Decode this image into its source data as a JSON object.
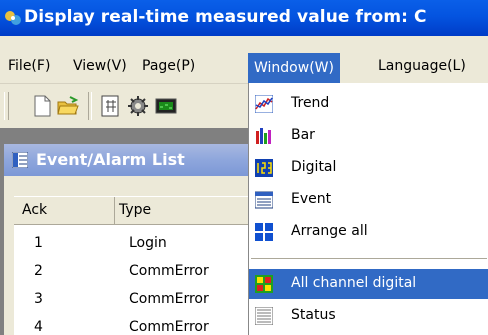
{
  "window": {
    "title": "Display real-time measured value from: C"
  },
  "menubar": {
    "items": [
      {
        "label": "File(F)"
      },
      {
        "label": "View(V)"
      },
      {
        "label": "Page(P)"
      },
      {
        "label": "Window(W)"
      },
      {
        "label": "Language(L)"
      }
    ],
    "active": "Window(W)"
  },
  "toolbar": {
    "icons": [
      "new-document-icon",
      "open-folder-icon",
      "grid-icon",
      "gear-icon",
      "monitor-icon"
    ]
  },
  "child_window": {
    "title": "Event/Alarm List",
    "columns": [
      "Ack",
      "Type"
    ],
    "rows": [
      {
        "ack": "1",
        "type": "Login"
      },
      {
        "ack": "2",
        "type": "CommError"
      },
      {
        "ack": "3",
        "type": "CommError"
      },
      {
        "ack": "4",
        "type": "CommError"
      }
    ]
  },
  "window_menu": {
    "items": [
      {
        "label": "Trend",
        "icon": "trend-chart-icon"
      },
      {
        "label": "Bar",
        "icon": "bar-chart-icon"
      },
      {
        "label": "Digital",
        "icon": "digital-icon"
      },
      {
        "label": "Event",
        "icon": "event-list-icon"
      },
      {
        "label": "Arrange all",
        "icon": "arrange-all-icon"
      },
      {
        "label": "All channel digital",
        "icon": "all-channel-digital-icon",
        "highlighted": true
      },
      {
        "label": "Status",
        "icon": "status-icon"
      }
    ]
  },
  "colors": {
    "title_bar": "#0454e0",
    "highlight": "#316ac5",
    "menu_bg": "#ece9d8"
  }
}
